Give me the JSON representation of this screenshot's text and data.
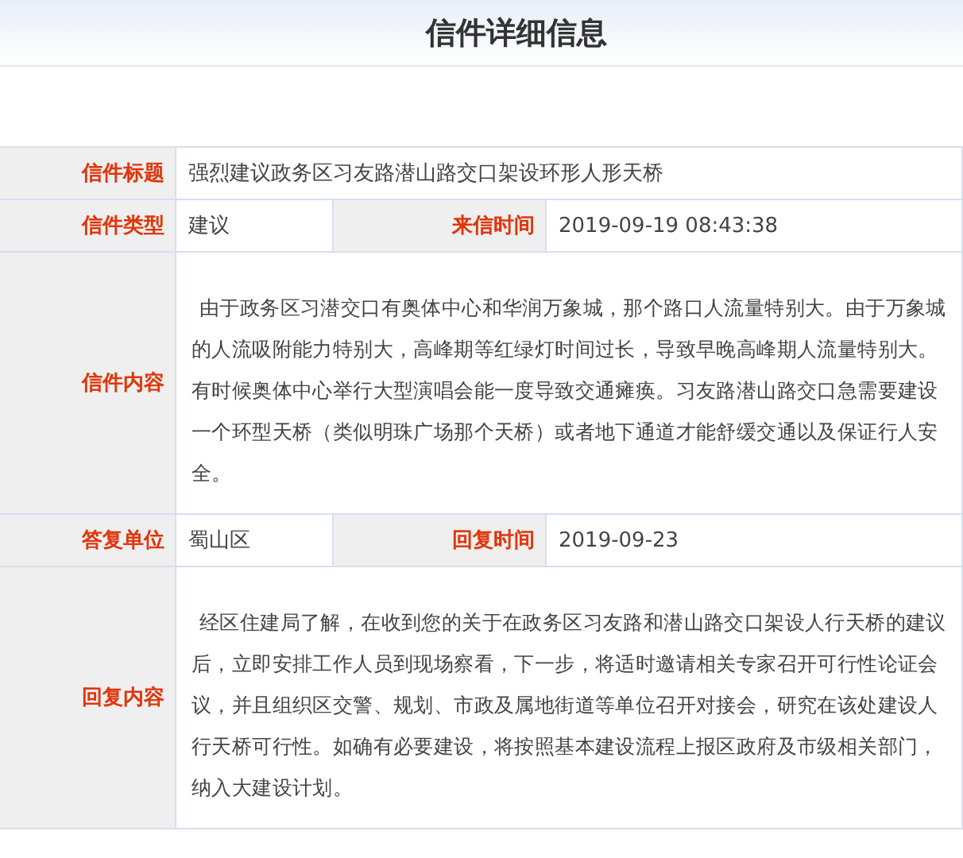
{
  "title": "信件详细信息",
  "rows": [
    {
      "kind": "wide",
      "label": "信件标题",
      "value": "强烈建议政务区习友路潜山路交口架设环形人形天桥"
    },
    {
      "kind": "pair",
      "fields": [
        {
          "label": "信件类型",
          "value": "建议"
        },
        {
          "label": "来信时间",
          "value": "2019-09-19 08:43:38"
        }
      ]
    },
    {
      "kind": "text",
      "label": "信件内容",
      "value": "由于政务区习潜交口有奥体中心和华润万象城，那个路口人流量特别大。由于万象城的人流吸附能力特别大，高峰期等红绿灯时间过长，导致早晚高峰期人流量特别大。有时候奥体中心举行大型演唱会能一度导致交通瘫痪。习友路潜山路交口急需要建设一个环型天桥（类似明珠广场那个天桥）或者地下通道才能舒缓交通以及保证行人安全。"
    },
    {
      "kind": "pair",
      "fields": [
        {
          "label": "答复单位",
          "value": "蜀山区"
        },
        {
          "label": "回复时间",
          "value": "2019-09-23"
        }
      ]
    },
    {
      "kind": "text",
      "label": "回复内容",
      "value": "经区住建局了解，在收到您的关于在政务区习友路和潜山路交口架设人行天桥的建议后，立即安排工作人员到现场察看，下一步，将适时邀请相关专家召开可行性论证会议，并且组织区交警、规划、市政及属地街道等单位召开对接会，研究在该处建设人行天桥可行性。如确有必要建设，将按照基本建设流程上报区政府及市级相关部门，纳入大建设计划。"
    }
  ]
}
